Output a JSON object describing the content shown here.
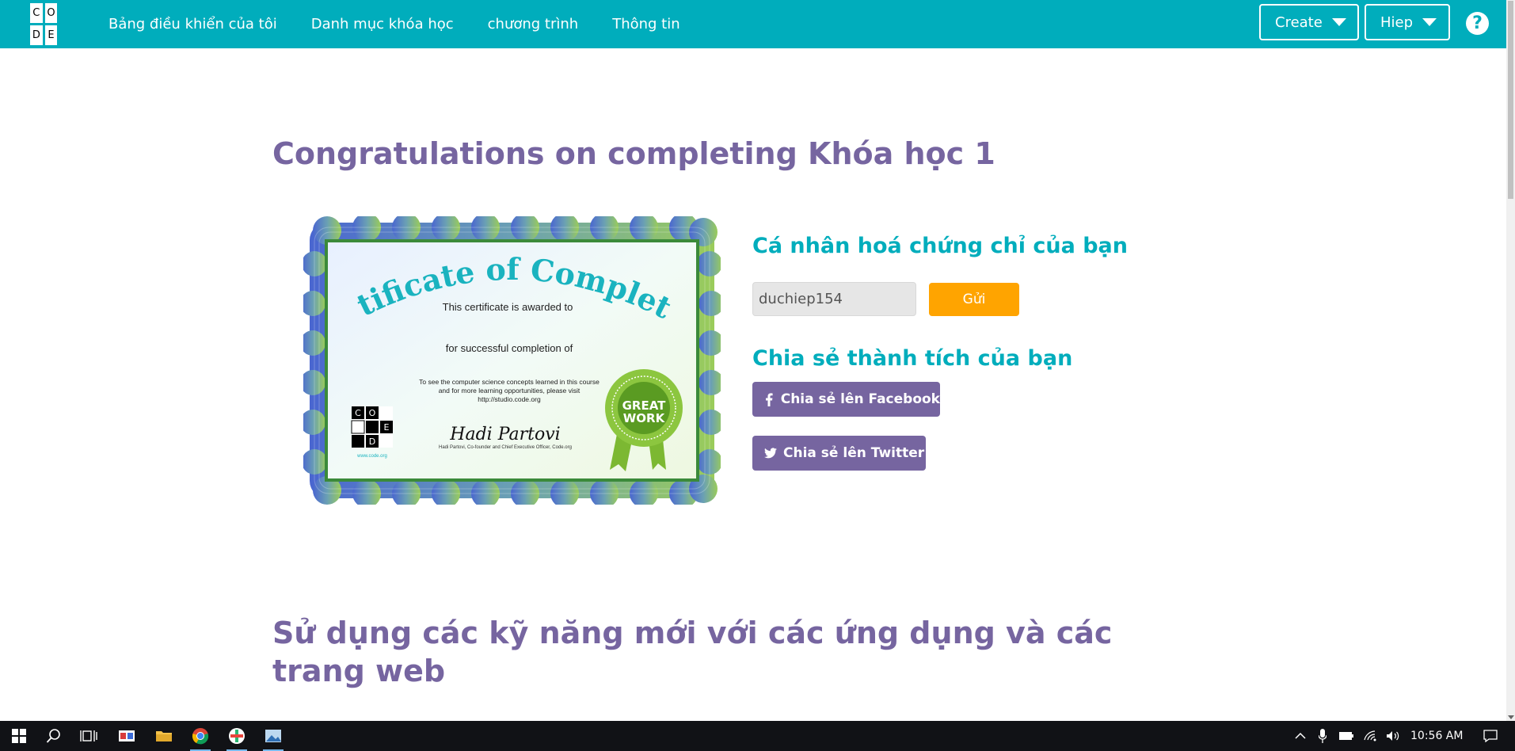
{
  "logo": {
    "letters": [
      "C",
      "O",
      "D",
      "E"
    ]
  },
  "nav": {
    "items": [
      {
        "label": "Bảng điều khiển của tôi"
      },
      {
        "label": "Danh mục khóa học"
      },
      {
        "label": "chương trình"
      },
      {
        "label": "Thông tin"
      }
    ],
    "create_label": "Create",
    "user_label": "Hiep",
    "help_label": "?"
  },
  "main": {
    "title": "Congratulations on completing Khóa học 1",
    "personalize_title": "Cá nhân hoá chứng chỉ của bạn",
    "name_value": "duchiep154",
    "submit_label": "Gửi",
    "share_title": "Chia sẻ thành tích của bạn",
    "facebook_label": "Chia sẻ lên Facebook",
    "twitter_label": "Chia sẻ lên Twitter",
    "section_title": "Sử dụng các kỹ năng mới với các ứng dụng và các trang web"
  },
  "certificate": {
    "heading": "Certificate of Completion",
    "awarded_to": "This certificate is awarded to",
    "completion_of": "for successful completion of",
    "note_line1": "To see the computer science concepts learned in this course",
    "note_line2": "and for more learning opportunities, please visit",
    "note_line3": "http://studio.code.org",
    "signer": "Hadi Partovi, Co-founder and Chief Executive Officer, Code.org",
    "signature": "Hadi Partovi",
    "logo_url": "www.code.org",
    "badge_top": "GREAT",
    "badge_bottom": "WORK"
  },
  "taskbar": {
    "time": "10:56 AM"
  },
  "colors": {
    "brand_teal": "#00adbc",
    "purple": "#7665a0",
    "orange": "#ffa400"
  }
}
